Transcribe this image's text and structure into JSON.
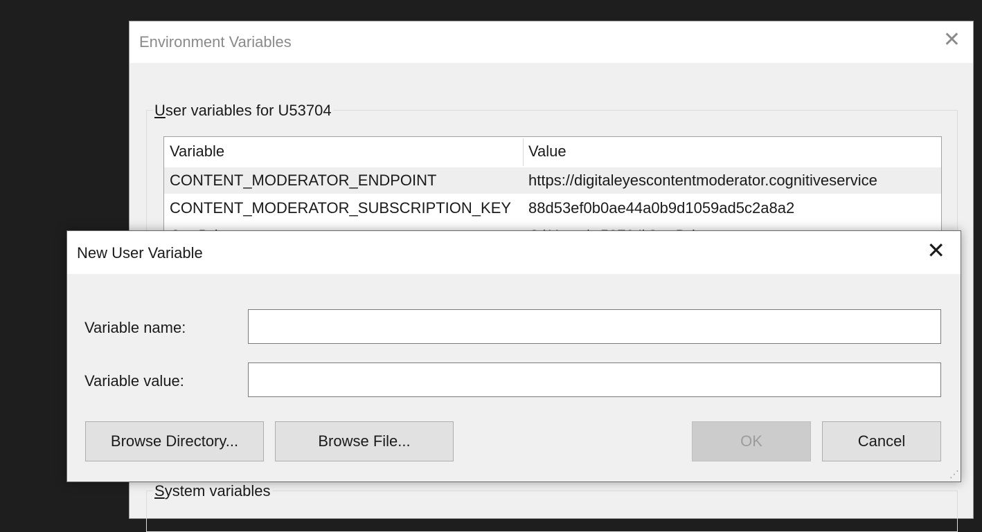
{
  "env_window": {
    "title": "Environment Variables",
    "close_glyph": "✕",
    "user_group": {
      "label_accel": "U",
      "label_rest": "ser variables for U53704",
      "columns": [
        "Variable",
        "Value"
      ],
      "rows": [
        {
          "name": "CONTENT_MODERATOR_ENDPOINT",
          "value": "https://digitaleyescontentmoderator.cognitiveservice"
        },
        {
          "name": "CONTENT_MODERATOR_SUBSCRIPTION_KEY",
          "value": "88d53ef0b0ae44a0b9d1059ad5c2a8a2"
        },
        {
          "name": "OneDrive",
          "value": "C:\\Users\\u53704\\OneDrive"
        }
      ]
    },
    "system_group": {
      "label_accel": "S",
      "label_rest": "ystem variables"
    }
  },
  "dialog": {
    "title": "New User Variable",
    "close_glyph": "✕",
    "name_label": "Variable name:",
    "name_value": "",
    "value_label": "Variable value:",
    "value_value": "",
    "buttons": {
      "browse_directory": "Browse Directory...",
      "browse_file": "Browse File...",
      "ok": "OK",
      "cancel": "Cancel"
    },
    "grip_glyph": "⋰"
  }
}
